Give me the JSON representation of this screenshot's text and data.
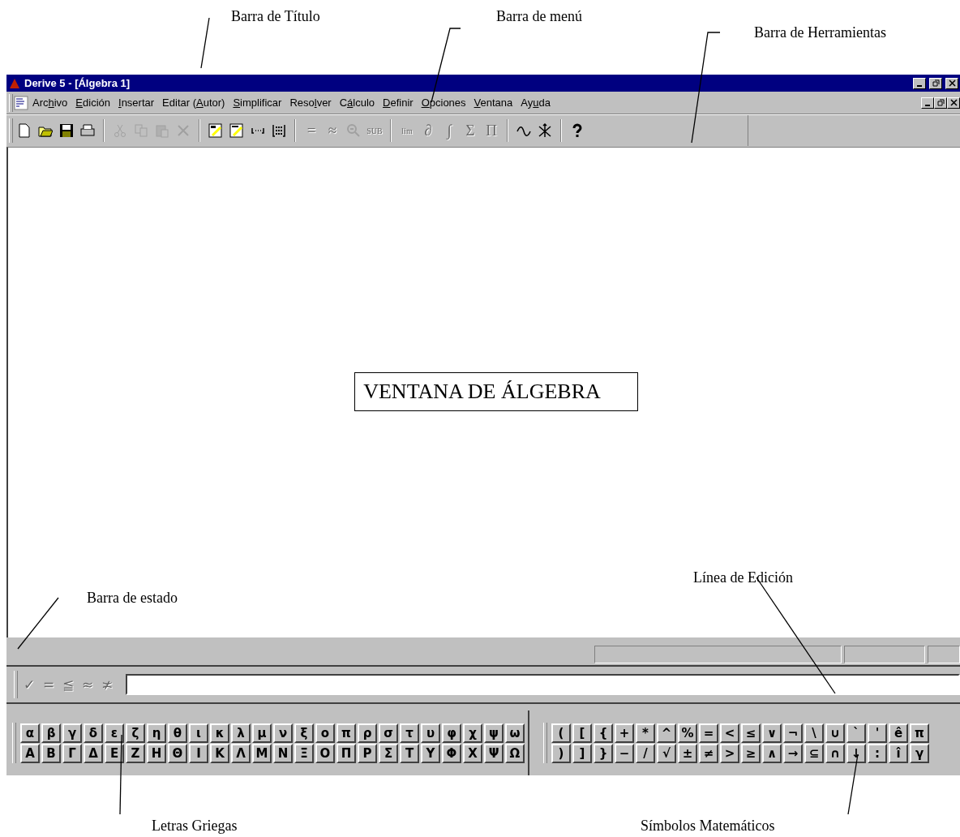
{
  "annotations": [
    "Barra de Título",
    "Barra de menú",
    "Barra de Herramientas",
    "Barra de estado",
    "Línea de Edición",
    "Letras Griegas",
    "Símbolos Matemáticos"
  ],
  "window": {
    "title": "Derive 5 - [Álgebra 1]"
  },
  "menu": [
    {
      "before": "Arc",
      "key": "h",
      "after": "ivo"
    },
    {
      "key": "E",
      "after": "dición"
    },
    {
      "key": "I",
      "after": "nsertar"
    },
    {
      "before": "Editar (",
      "key": "A",
      "after": "utor)"
    },
    {
      "key": "S",
      "after": "implificar"
    },
    {
      "before": "Reso",
      "key": "l",
      "after": "ver"
    },
    {
      "before": "C",
      "key": "á",
      "after": "lculo"
    },
    {
      "key": "D",
      "after": "efinir"
    },
    {
      "key": "O",
      "after": "pciones"
    },
    {
      "key": "V",
      "after": "entana"
    },
    {
      "before": "Ay",
      "key": "u",
      "after": "da"
    }
  ],
  "toolbar": [
    [
      {
        "kind": "new",
        "disabled": false
      },
      {
        "kind": "open",
        "disabled": false
      },
      {
        "kind": "save",
        "disabled": false
      },
      {
        "kind": "print",
        "disabled": false
      }
    ],
    [
      {
        "kind": "cut",
        "disabled": true
      },
      {
        "kind": "copy",
        "disabled": true
      },
      {
        "kind": "paste",
        "disabled": true
      },
      {
        "kind": "delete",
        "disabled": true
      }
    ],
    [
      {
        "kind": "author",
        "disabled": false
      },
      {
        "kind": "expression",
        "disabled": false
      },
      {
        "kind": "vector",
        "disabled": false
      },
      {
        "kind": "matrix",
        "disabled": false
      }
    ],
    [
      {
        "kind": "glyph",
        "text": "=",
        "disabled": true
      },
      {
        "kind": "glyph",
        "text": "≈",
        "disabled": true
      },
      {
        "kind": "zoom",
        "disabled": true
      },
      {
        "kind": "glyph",
        "text": "SUB",
        "disabled": true
      }
    ],
    [
      {
        "kind": "glyph",
        "text": "lim",
        "disabled": true
      },
      {
        "kind": "glyph",
        "text": "∂",
        "disabled": true
      },
      {
        "kind": "glyph",
        "text": "∫",
        "disabled": true
      },
      {
        "kind": "glyph",
        "text": "Σ",
        "disabled": true
      },
      {
        "kind": "glyph",
        "text": "Π",
        "disabled": true
      }
    ],
    [
      {
        "kind": "plot",
        "disabled": false
      },
      {
        "kind": "axes",
        "disabled": false
      }
    ],
    [
      {
        "kind": "help",
        "disabled": false
      }
    ]
  ],
  "algebra_window": {
    "label": "VENTANA DE ÁLGEBRA"
  },
  "edit_line": {
    "tools": [
      "✓",
      "=",
      "≦",
      "≈",
      "≭"
    ]
  },
  "greek": {
    "lower": [
      "α",
      "β",
      "γ",
      "δ",
      "ε",
      "ζ",
      "η",
      "θ",
      "ι",
      "κ",
      "λ",
      "μ",
      "ν",
      "ξ",
      "ο",
      "π",
      "ρ",
      "σ",
      "τ",
      "υ",
      "φ",
      "χ",
      "ψ",
      "ω"
    ],
    "upper": [
      "Α",
      "Β",
      "Γ",
      "Δ",
      "Ε",
      "Ζ",
      "Η",
      "Θ",
      "Ι",
      "Κ",
      "Λ",
      "Μ",
      "Ν",
      "Ξ",
      "Ο",
      "Π",
      "Ρ",
      "Σ",
      "Τ",
      "Υ",
      "Φ",
      "Χ",
      "Ψ",
      "Ω"
    ]
  },
  "math": {
    "top": [
      "(",
      "[",
      "{",
      "+",
      "*",
      "^",
      "%",
      "=",
      "<",
      "≤",
      "∨",
      "¬",
      "\\",
      "∪",
      "`",
      "'",
      "ê",
      "π"
    ],
    "bottom": [
      ")",
      "]",
      "}",
      "−",
      "/",
      "√",
      "±",
      "≠",
      ">",
      "≥",
      "∧",
      "→",
      "⊆",
      "∩",
      "↓",
      ":",
      "î",
      "γ"
    ]
  }
}
